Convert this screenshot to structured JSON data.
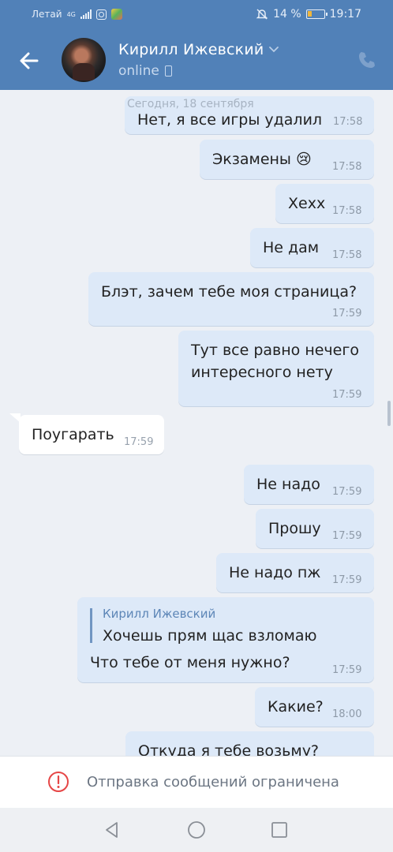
{
  "status_bar": {
    "carrier": "Летай",
    "network": "4G",
    "battery": "14 %",
    "time": "19:17"
  },
  "header": {
    "contact_name": "Кирилл Ижевский",
    "status": "online",
    "accent_color": "#5181b8"
  },
  "messages": {
    "date_separator": "Сегодня, 18 сентября",
    "items": [
      {
        "dir": "out",
        "text": "Нет, я все игры удалил",
        "time": "17:58"
      },
      {
        "dir": "out",
        "text": "Экзамены 😢",
        "time": "17:58"
      },
      {
        "dir": "out",
        "text": "Хехх",
        "time": "17:58"
      },
      {
        "dir": "out",
        "text": "Не дам",
        "time": "17:58"
      },
      {
        "dir": "out",
        "text": "Блэт, зачем тебе моя страница?",
        "time": "17:59"
      },
      {
        "dir": "out",
        "text_line1": "Тут все равно нечего",
        "text_line2": "интересного нету",
        "time": "17:59"
      },
      {
        "dir": "in",
        "text": "Поугарать",
        "time": "17:59"
      },
      {
        "dir": "out",
        "text": "Не надо",
        "time": "17:59"
      },
      {
        "dir": "out",
        "text": "Прошу",
        "time": "17:59"
      },
      {
        "dir": "out",
        "text": "Не надо пж",
        "time": "17:59"
      },
      {
        "dir": "out",
        "reply_author": "Кирилл Ижевский",
        "reply_text": "Хочешь прям щас взломаю",
        "text": "Что тебе от меня нужно?",
        "time": "17:59"
      },
      {
        "dir": "out",
        "text": "Какие?",
        "time": "18:00"
      },
      {
        "dir": "out",
        "text": "Откуда я тебе возьму?",
        "time": ""
      }
    ]
  },
  "restriction": {
    "text": "Отправка сообщений ограничена",
    "icon": "alert-circle-icon"
  },
  "nav": {
    "back": "back-triangle-icon",
    "home": "home-circle-icon",
    "recent": "recent-square-icon"
  }
}
